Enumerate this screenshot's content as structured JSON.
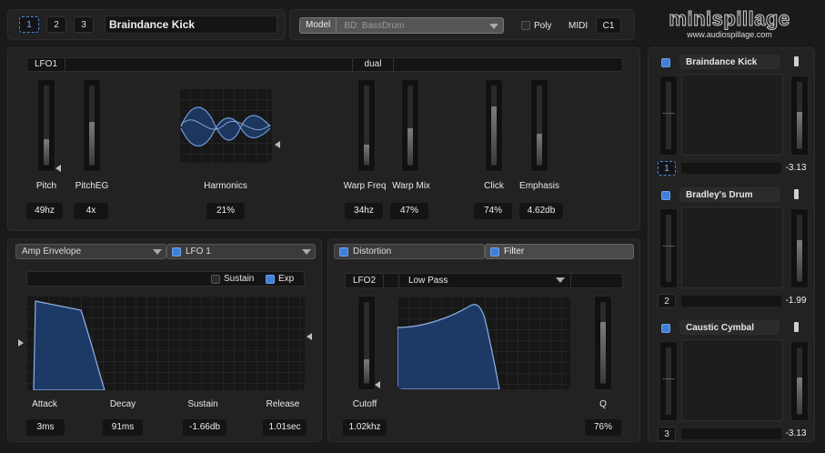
{
  "header": {
    "patch_buttons": [
      "1",
      "2",
      "3"
    ],
    "patch_name": "Braindance Kick",
    "model_label": "Model",
    "model_value": "BD: BassDrum",
    "poly_label": "Poly",
    "midi_label": "MIDI",
    "midi_value": "C1",
    "brand": "minispillage",
    "brand_url": "www.audiospillage.com"
  },
  "osc": {
    "lfo_label": "LFO1",
    "mode_label": "dual",
    "controls": [
      {
        "label": "Pitch",
        "value": "49hz",
        "level": 0.33
      },
      {
        "label": "PitchEG",
        "value": "4x",
        "level": 0.55
      },
      {
        "label": "Harmonics",
        "value": "21%"
      },
      {
        "label": "Warp Freq",
        "value": "34hz",
        "level": 0.25
      },
      {
        "label": "Warp Mix",
        "value": "47%",
        "level": 0.47
      },
      {
        "label": "Click",
        "value": "74%",
        "level": 0.74
      },
      {
        "label": "Emphasis",
        "value": "4.62db",
        "level": 0.4
      }
    ]
  },
  "env": {
    "env_select": "Amp Envelope",
    "lfo_select": "LFO 1",
    "sustain_label": "Sustain",
    "exp_label": "Exp",
    "params": [
      {
        "label": "Attack",
        "value": "3ms"
      },
      {
        "label": "Decay",
        "value": "91ms"
      },
      {
        "label": "Sustain",
        "value": "-1.66db"
      },
      {
        "label": "Release",
        "value": "1.01sec"
      }
    ]
  },
  "filter": {
    "tab_distortion": "Distortion",
    "tab_filter": "Filter",
    "lfo_label": "LFO2",
    "type": "Low Pass",
    "cutoff_label": "Cutoff",
    "cutoff_value": "1.02khz",
    "cutoff_level": 0.3,
    "q_label": "Q",
    "q_value": "76%",
    "q_level": 0.76
  },
  "channels": [
    {
      "name": "Braindance Kick",
      "number": "1",
      "value": "-3.13",
      "level": 0.55
    },
    {
      "name": "Bradley's Drum",
      "number": "2",
      "value": "-1.99",
      "level": 0.62
    },
    {
      "name": "Caustic Cymbal",
      "number": "3",
      "value": "-3.13",
      "level": 0.55
    }
  ],
  "colors": {
    "accent": "#3f7fd8",
    "wave": "#4a78b8",
    "fill": "#1d3a66"
  }
}
